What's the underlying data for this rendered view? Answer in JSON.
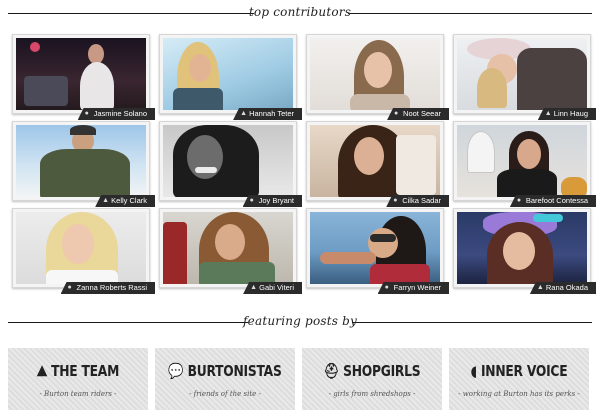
{
  "top_section": {
    "heading": "top contributors"
  },
  "contributors": [
    {
      "name": "Jasmine Solano",
      "icon": "person-icon"
    },
    {
      "name": "Hannah Teter",
      "icon": "mountain-icon"
    },
    {
      "name": "Noot Seear",
      "icon": "speech-bubble-icon"
    },
    {
      "name": "Linn Haug",
      "icon": "mountain-icon"
    },
    {
      "name": "Kelly Clark",
      "icon": "mountain-icon"
    },
    {
      "name": "Joy Bryant",
      "icon": "speech-bubble-icon"
    },
    {
      "name": "Cilka Sadar",
      "icon": "person-icon"
    },
    {
      "name": "Barefoot Contessa",
      "icon": "speech-bubble-icon"
    },
    {
      "name": "Zanna Roberts Rassi",
      "icon": "speech-bubble-icon"
    },
    {
      "name": "Gabi Viteri",
      "icon": "mountain-icon"
    },
    {
      "name": "Farryn Weiner",
      "icon": "speech-bubble-icon"
    },
    {
      "name": "Rana Okada",
      "icon": "mountain-icon"
    }
  ],
  "featuring_section": {
    "heading": "featuring posts by"
  },
  "features": [
    {
      "title": "THE TEAM",
      "subtitle": "- Burton team riders -",
      "icon": "mountain-icon"
    },
    {
      "title": "BURTONISTAS",
      "subtitle": "- friends of the site -",
      "icon": "speech-bubble-icon"
    },
    {
      "title": "SHOPGIRLS",
      "subtitle": "- girls from shredshops -",
      "icon": "helmet-icon"
    },
    {
      "title": "INNER VOICE",
      "subtitle": "- working at Burton has its perks -",
      "icon": "burton-logo-icon"
    }
  ],
  "colors": {
    "tag_bg": "#2b2b2b",
    "card_bg": "#f4f4f4",
    "feature_bg": "#e4e4e4"
  }
}
